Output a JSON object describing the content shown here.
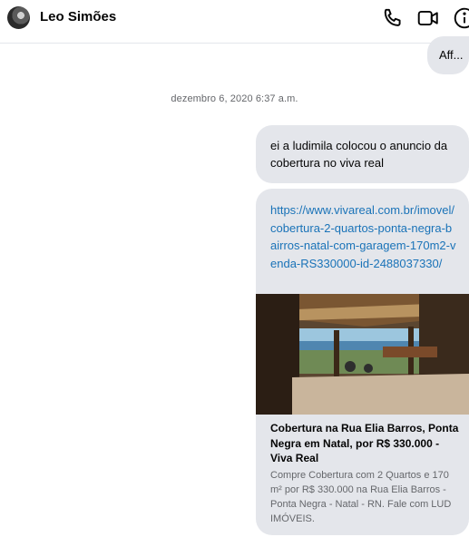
{
  "header": {
    "contact_name": "Leo Simões",
    "icons": [
      "avatar",
      "phone-icon",
      "video-camera-icon",
      "info-icon"
    ]
  },
  "messages": {
    "previous_tail": "Aff...",
    "timestamp": "dezembro 6, 2020 6:37 a.m.",
    "text_message": "ei a ludimila colocou o anuncio da cobertura no viva real",
    "link_message": {
      "url": "https://www.vivareal.com.br/imovel/cobertura-2-quartos-ponta-negra-bairros-natal-com-garagem-170m2-venda-RS330000-id-2488037330/",
      "preview_title": "Cobertura na Rua Elia Barros, Ponta Negra em Natal, por R$ 330.000 - Viva Real",
      "preview_description": "Compre Cobertura com 2 Quartos e 170 m² por R$ 330.000 na Rua Elia Barros - Ponta Negra - Natal - RN. Fale com LUD IMÓVEIS."
    }
  },
  "colors": {
    "bubble_background": "#e4e6eb",
    "link_color": "#1a73b8",
    "secondary_text": "#65676b"
  }
}
